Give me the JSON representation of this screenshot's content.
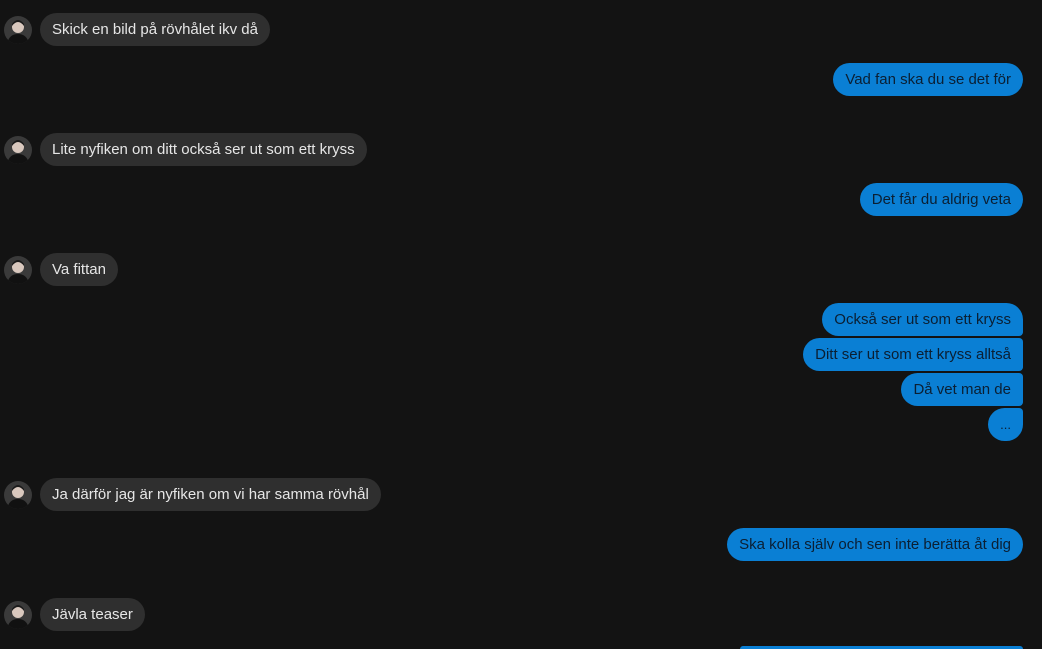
{
  "messages": [
    {
      "text": "Skick en bild på rövhålet ikv då"
    },
    {
      "text": "Vad fan ska du se det för"
    },
    {
      "text": "Lite nyfiken om ditt också ser ut som ett kryss"
    },
    {
      "text": "Det får du aldrig veta"
    },
    {
      "text": "Va fittan"
    },
    {
      "text": "Också ser ut som ett kryss"
    },
    {
      "text": "Ditt ser ut som ett kryss alltså"
    },
    {
      "text": "Då vet man de"
    },
    {
      "text": "..."
    },
    {
      "text": "Ja därför jag är nyfiken om vi har samma rövhål"
    },
    {
      "text": "Ska kolla själv och sen inte berätta åt dig"
    },
    {
      "text": "Jävla teaser"
    }
  ],
  "colors": {
    "background": "#131313",
    "incoming_bubble": "#2f2f2f",
    "outgoing_bubble": "#0a7fd4"
  }
}
